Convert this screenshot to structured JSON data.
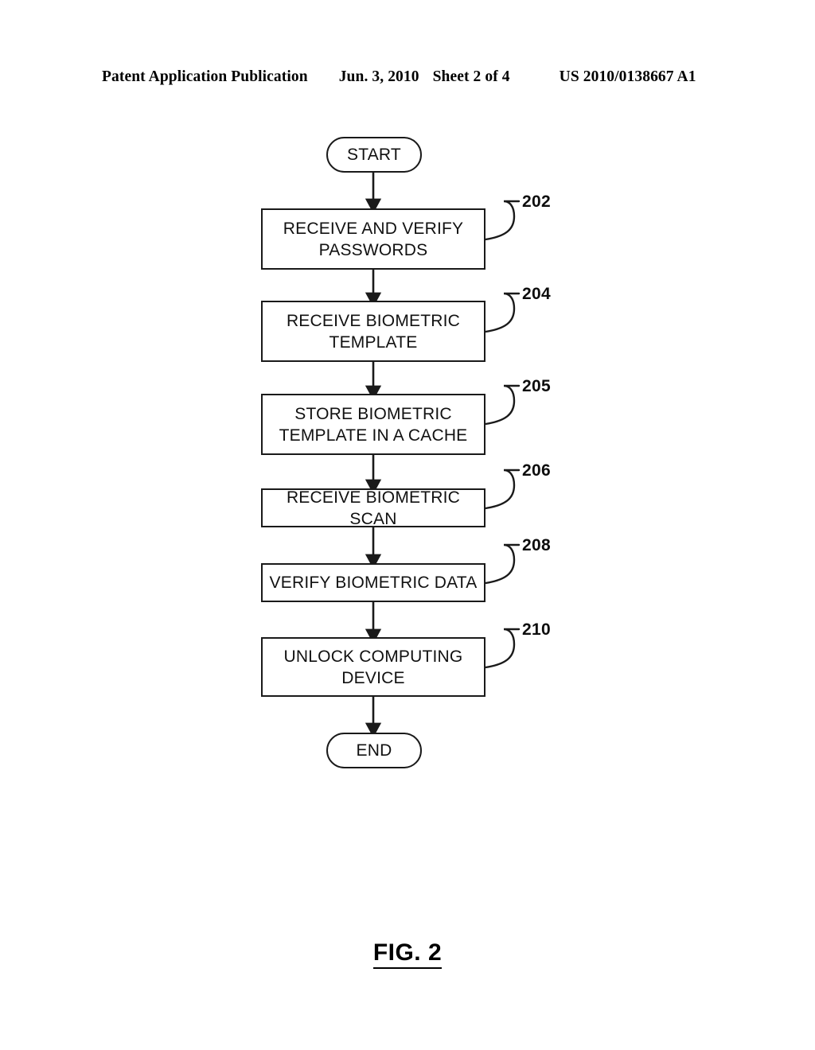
{
  "header": {
    "publication": "Patent Application Publication",
    "date": "Jun. 3, 2010",
    "sheet": "Sheet 2 of 4",
    "patent_number": "US 2010/0138667 A1"
  },
  "figure": {
    "caption": "FIG. 2",
    "type": "flowchart",
    "nodes": [
      {
        "id": "start",
        "shape": "terminal",
        "label": "START",
        "ref": null
      },
      {
        "id": "n202",
        "shape": "process",
        "label": "RECEIVE AND VERIFY PASSWORDS",
        "ref": "202"
      },
      {
        "id": "n204",
        "shape": "process",
        "label": "RECEIVE BIOMETRIC TEMPLATE",
        "ref": "204"
      },
      {
        "id": "n205",
        "shape": "process",
        "label": "STORE BIOMETRIC TEMPLATE IN A CACHE",
        "ref": "205"
      },
      {
        "id": "n206",
        "shape": "process",
        "label": "RECEIVE BIOMETRIC SCAN",
        "ref": "206"
      },
      {
        "id": "n208",
        "shape": "process",
        "label": "VERIFY BIOMETRIC DATA",
        "ref": "208"
      },
      {
        "id": "n210",
        "shape": "process",
        "label": "UNLOCK COMPUTING DEVICE",
        "ref": "210"
      },
      {
        "id": "end",
        "shape": "terminal",
        "label": "END",
        "ref": null
      }
    ],
    "edges": [
      {
        "from": "start",
        "to": "n202"
      },
      {
        "from": "n202",
        "to": "n204"
      },
      {
        "from": "n204",
        "to": "n205"
      },
      {
        "from": "n205",
        "to": "n206"
      },
      {
        "from": "n206",
        "to": "n208"
      },
      {
        "from": "n208",
        "to": "n210"
      },
      {
        "from": "n210",
        "to": "end"
      }
    ],
    "line_color": "#1a1a1a"
  }
}
